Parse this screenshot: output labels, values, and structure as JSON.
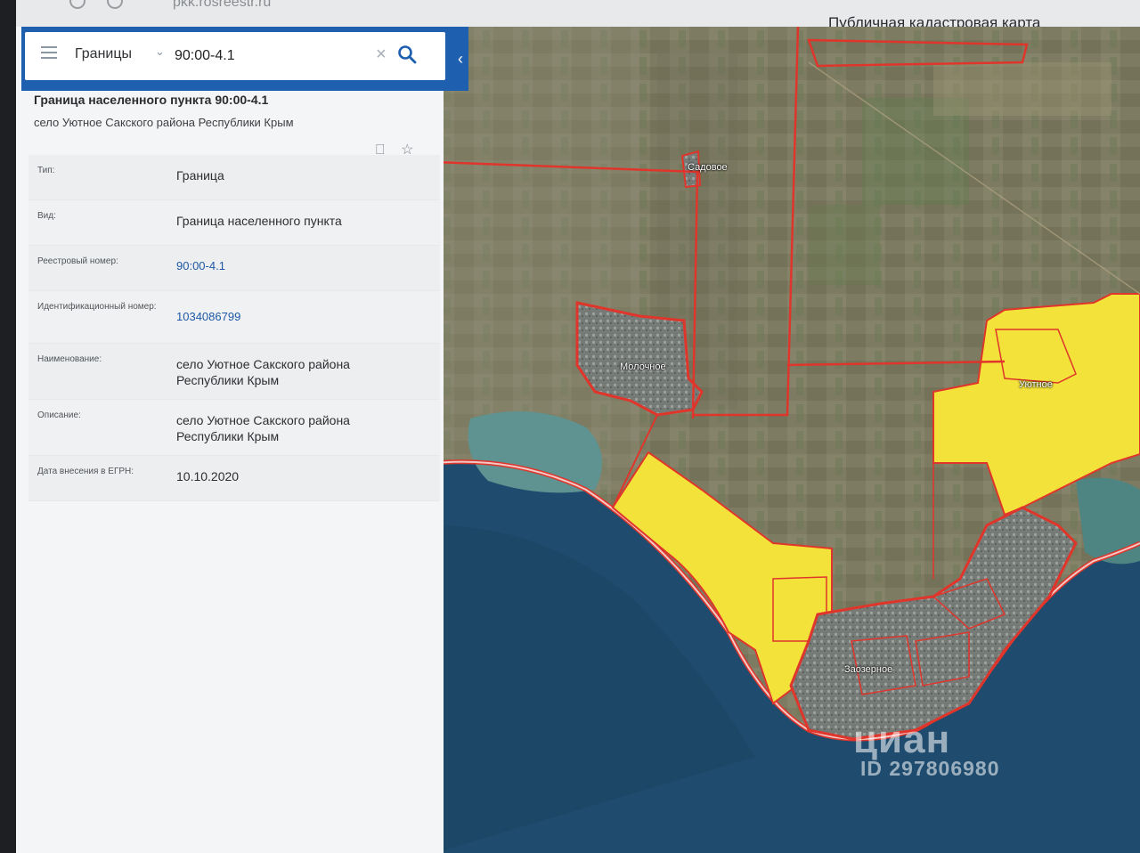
{
  "browser": {
    "url": "pkk.rosreestr.ru"
  },
  "app": {
    "title": "Публичная кадастровая карта"
  },
  "search": {
    "layer": "Границы",
    "query": "90:00-4.1"
  },
  "card": {
    "title": "Граница населенного пункта 90:00-4.1",
    "subtitle": "село Уютное Сакского района Республики Крым",
    "rows": [
      {
        "label": "Тип:",
        "value": "Граница"
      },
      {
        "label": "Вид:",
        "value": "Граница населенного пункта"
      },
      {
        "label": "Реестровый номер:",
        "value": "90:00-4.1"
      },
      {
        "label": "Идентификационный номер:",
        "value": "1034086799"
      },
      {
        "label": "Наименование:",
        "value": "село Уютное Сакского района Республики Крым"
      },
      {
        "label": "Описание:",
        "value": "село Уютное Сакского района Республики Крым"
      },
      {
        "label": "Дата внесения в ЕГРН:",
        "value": "10.10.2020"
      }
    ]
  },
  "map": {
    "places": [
      "Садовое",
      "Молочное",
      "Уютное",
      "Заозерное"
    ],
    "colors": {
      "boundary": "#e0352b",
      "highlight": "#f2e23a",
      "sea": "#1f4c6e",
      "land": "#8b8a6e"
    }
  },
  "watermark": {
    "brand": "циан",
    "id": "ID 297806980"
  }
}
